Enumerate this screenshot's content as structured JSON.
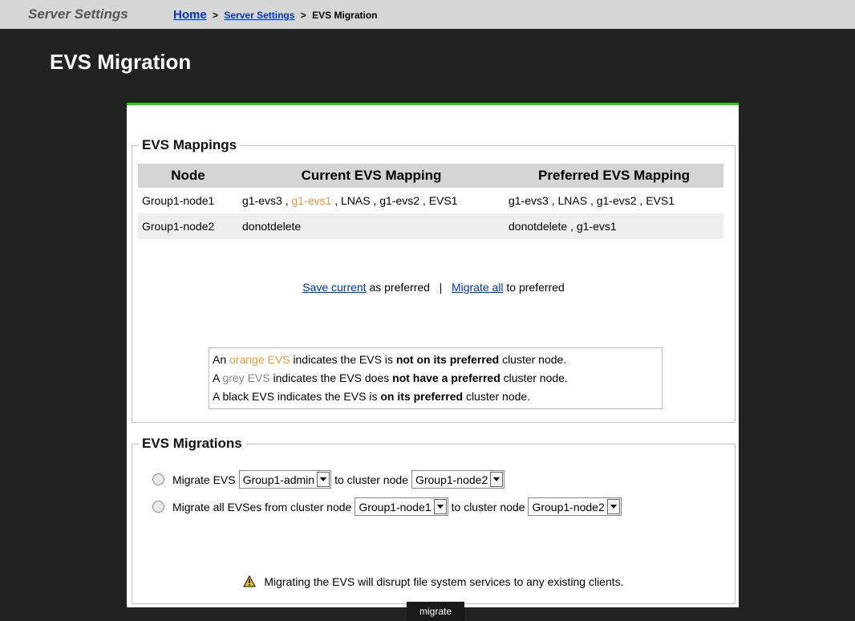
{
  "header": {
    "app_title": "Server Settings",
    "breadcrumb": {
      "home": "Home",
      "sep1": ">",
      "server_settings": "Server Settings",
      "sep2": ">",
      "current": "EVS Migration"
    }
  },
  "page": {
    "title": "EVS Migration"
  },
  "mappings": {
    "legend": "EVS Mappings",
    "columns": [
      "Node",
      "Current EVS Mapping",
      "Preferred EVS Mapping"
    ],
    "rows": [
      {
        "node": "Group1-node1",
        "current": [
          {
            "name": "g1-evs3",
            "status": "black"
          },
          {
            "name": "g1-evs1",
            "status": "orange"
          },
          {
            "name": "LNAS",
            "status": "black"
          },
          {
            "name": "g1-evs2",
            "status": "black"
          },
          {
            "name": "EVS1",
            "status": "black"
          }
        ],
        "preferred": "g1-evs3 , LNAS , g1-evs2 , EVS1"
      },
      {
        "node": "Group1-node2",
        "current": [
          {
            "name": "donotdelete",
            "status": "black"
          }
        ],
        "preferred": "donotdelete , g1-evs1"
      }
    ],
    "separator": ",",
    "actions": {
      "save_link": "Save current",
      "save_suffix": "as preferred",
      "divider": "|",
      "migrate_link": "Migrate all",
      "migrate_suffix": "to preferred"
    },
    "legend_lines": {
      "l1": {
        "prefix": "An",
        "colored": "orange EVS",
        "mid": "indicates the EVS is",
        "bold": "not on its preferred",
        "suffix": "cluster node."
      },
      "l2": {
        "prefix": "A",
        "colored": "grey EVS",
        "mid": "indicates the EVS does",
        "bold": "not have a preferred",
        "suffix": "cluster node."
      },
      "l3": {
        "prefix": "A black EVS indicates the EVS is",
        "bold": "on its preferred",
        "suffix": "cluster node."
      }
    }
  },
  "migrations": {
    "legend": "EVS Migrations",
    "option1": {
      "label": "Migrate EVS",
      "evs_select": "Group1-admin",
      "to_label": "to cluster node",
      "node_select": "Group1-node2"
    },
    "option2": {
      "label": "Migrate all EVSes from cluster node",
      "from_select": "Group1-node1",
      "to_label": "to cluster node",
      "to_select": "Group1-node2"
    },
    "warning": "Migrating the EVS will disrupt file system services to any existing clients.",
    "button": "migrate"
  },
  "colors": {
    "orange": "#f39c3c",
    "grey": "#888888",
    "accent_green": "#3cbf2c",
    "link": "#0033cc"
  }
}
